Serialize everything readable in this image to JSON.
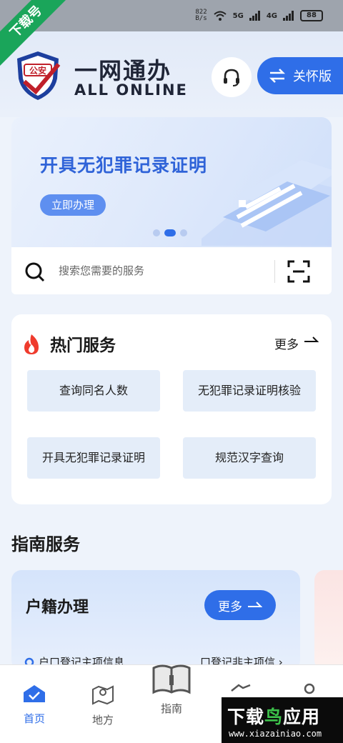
{
  "status_bar": {
    "speed_value": "822",
    "speed_unit": "B/s",
    "net1": "5G",
    "net2": "4G",
    "battery": "88"
  },
  "corner_badge": "下载号",
  "header": {
    "logo_badge_text": "公安",
    "title": "一网通办",
    "subtitle": "ALL ONLINE",
    "care_label": "关怀版"
  },
  "banner": {
    "title": "开具无犯罪记录证明",
    "button_label": "立即办理",
    "page_index": 2,
    "page_count": 3
  },
  "search": {
    "placeholder": "搜索您需要的服务"
  },
  "hot_services": {
    "title": "热门服务",
    "more_label": "更多",
    "items": [
      {
        "label": "查询同名人数"
      },
      {
        "label": "无犯罪记录证明核验"
      },
      {
        "label": "开具无犯罪记录证明"
      },
      {
        "label": "规范汉字查询"
      }
    ]
  },
  "guide": {
    "title": "指南服务",
    "card_title": "户籍办理",
    "more_label": "更多",
    "item_1": "户口登记主项信息",
    "item_2": "口登记非主项信"
  },
  "bottom_nav": {
    "items": [
      {
        "label": "首页"
      },
      {
        "label": "地方"
      },
      {
        "label": "指南"
      }
    ]
  },
  "watermark": {
    "title_left": "下载",
    "title_mid": "鸟",
    "title_right": "应用",
    "url": "www.xiazainiao.com"
  },
  "colors": {
    "accent": "#2f6ee8",
    "banner_title": "#2f63d8",
    "tile_bg": "#e4edf9"
  }
}
